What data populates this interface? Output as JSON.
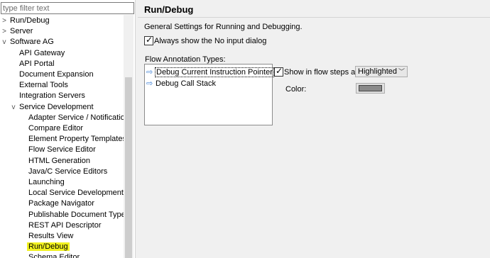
{
  "nav": {
    "filter_placeholder": "type filter text",
    "items": [
      {
        "label": "Run/Debug",
        "toggle": ">"
      },
      {
        "label": "Server",
        "toggle": ">"
      },
      {
        "label": "Software AG",
        "toggle": "v"
      },
      {
        "label": "API Gateway",
        "toggle": ""
      },
      {
        "label": "API Portal",
        "toggle": ""
      },
      {
        "label": "Document Expansion",
        "toggle": ""
      },
      {
        "label": "External Tools",
        "toggle": ""
      },
      {
        "label": "Integration Servers",
        "toggle": ""
      },
      {
        "label": "Service Development",
        "toggle": "v"
      },
      {
        "label": "Adapter Service / Notification",
        "toggle": ""
      },
      {
        "label": "Compare Editor",
        "toggle": ""
      },
      {
        "label": "Element Property Templates",
        "toggle": ""
      },
      {
        "label": "Flow Service Editor",
        "toggle": ""
      },
      {
        "label": "HTML Generation",
        "toggle": ""
      },
      {
        "label": "Java/C Service Editors",
        "toggle": ""
      },
      {
        "label": "Launching",
        "toggle": ""
      },
      {
        "label": "Local Service Development",
        "toggle": ""
      },
      {
        "label": "Package Navigator",
        "toggle": ""
      },
      {
        "label": "Publishable Document Type",
        "toggle": ""
      },
      {
        "label": "REST API Descriptor",
        "toggle": ""
      },
      {
        "label": "Results View",
        "toggle": ""
      },
      {
        "label": "Run/Debug",
        "toggle": ""
      },
      {
        "label": "Schema Editor",
        "toggle": ""
      }
    ]
  },
  "page": {
    "title": "Run/Debug",
    "description": "General Settings for Running and Debugging.",
    "always_show_label": "Always show the No input dialog",
    "always_show_checked": true,
    "flow_types_label": "Flow Annotation Types:",
    "flow_types": [
      {
        "label": "Debug Current Instruction Pointer",
        "icon": "arrow-icon"
      },
      {
        "label": "Debug Call Stack",
        "icon": "arrow-icon"
      }
    ],
    "show_in_flow_label": "Show in flow steps as:",
    "show_in_flow_checked": true,
    "show_as_value": "Highlighted",
    "color_label": "Color:",
    "color_value": "#8a8a8a"
  }
}
